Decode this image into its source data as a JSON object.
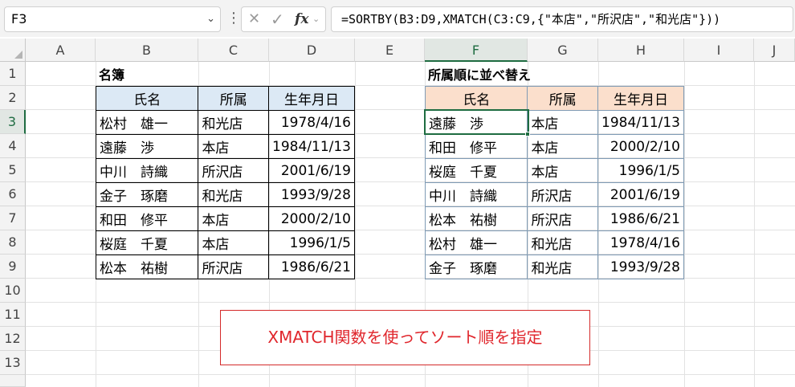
{
  "name_box": {
    "value": "F3"
  },
  "formula_bar": {
    "formula": "=SORTBY(B3:D9,XMATCH(C3:C9,{\"本店\",\"所沢店\",\"和光店\"}))",
    "fx_label": "fx",
    "cancel_icon": "close-icon",
    "enter_icon": "check-icon"
  },
  "columns": [
    "A",
    "B",
    "C",
    "D",
    "E",
    "F",
    "G",
    "H",
    "I",
    "J"
  ],
  "rows": [
    "1",
    "2",
    "3",
    "4",
    "5",
    "6",
    "7",
    "8",
    "9",
    "10",
    "11",
    "12",
    "13"
  ],
  "selected_column": "F",
  "selected_row": "3",
  "table1": {
    "title": "名簿",
    "headers": [
      "氏名",
      "所属",
      "生年月日"
    ],
    "rows": [
      [
        "松村　雄一",
        "和光店",
        "1978/4/16"
      ],
      [
        "遠藤　渉",
        "本店",
        "1984/11/13"
      ],
      [
        "中川　詩織",
        "所沢店",
        "2001/6/19"
      ],
      [
        "金子　琢磨",
        "和光店",
        "1993/9/28"
      ],
      [
        "和田　修平",
        "本店",
        "2000/2/10"
      ],
      [
        "桜庭　千夏",
        "本店",
        "1996/1/5"
      ],
      [
        "松本　祐樹",
        "所沢店",
        "1986/6/21"
      ]
    ]
  },
  "table2": {
    "title": "所属順に並べ替え",
    "headers": [
      "氏名",
      "所属",
      "生年月日"
    ],
    "rows": [
      [
        "遠藤　渉",
        "本店",
        "1984/11/13"
      ],
      [
        "和田　修平",
        "本店",
        "2000/2/10"
      ],
      [
        "桜庭　千夏",
        "本店",
        "1996/1/5"
      ],
      [
        "中川　詩織",
        "所沢店",
        "2001/6/19"
      ],
      [
        "松本　祐樹",
        "所沢店",
        "1986/6/21"
      ],
      [
        "松村　雄一",
        "和光店",
        "1978/4/16"
      ],
      [
        "金子　琢磨",
        "和光店",
        "1993/9/28"
      ]
    ]
  },
  "note": "XMATCH関数を使ってソート順を指定",
  "colors": {
    "accent": "#1e6c41",
    "note_red": "#e0262c",
    "table1_header": "#dce9f5",
    "table2_header": "#fbdfcc"
  }
}
